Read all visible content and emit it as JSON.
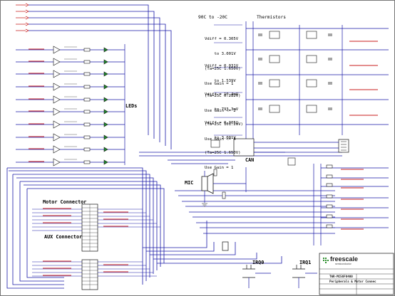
{
  "headings": {
    "temp_range": "90C to -20C",
    "thermistors": "Thermistors",
    "leds": "LEDs",
    "can": "CAN",
    "mic": "MIC",
    "motor_connector": "Motor Connector",
    "aux_connector": "AUX Connector",
    "irq0": "IRQ0",
    "irq1": "IRQ1"
  },
  "vdiff_blocks": [
    {
      "lines": [
        "Vdiff = 0.305V",
        "    to 3.001V",
        "(Ta=25C 1.650V)",
        "Use Gain = 1"
      ]
    },
    {
      "lines": [
        "Vdiff = 0.031V",
        "    to 1.539V",
        "(Ta=25C 0.282V)",
        "Use Gain <= 2"
      ]
    },
    {
      "lines": [
        "Vdiff = 10.4mV",
        "    to 793.3mV",
        "(Ta=25C 101.2mV)",
        "Use Gain <= 4"
      ]
    },
    {
      "lines": [
        "Vdiff = 0.305V",
        "    to 3.001V",
        "(Ta=25C 1.650V)",
        "Use Gain = 1"
      ]
    }
  ],
  "title_block": {
    "logo": "freescale",
    "logo_sub": "semiconductor",
    "board": "TWR-MC56F8400",
    "sheet_title": "Peripherals & Motor Connec"
  },
  "colors": {
    "net_blue": "#1a1aa8",
    "net_red": "#c81e1e",
    "net_green": "#1d8a2a",
    "ink": "#111111",
    "logo_green": "#2f8f2f"
  }
}
